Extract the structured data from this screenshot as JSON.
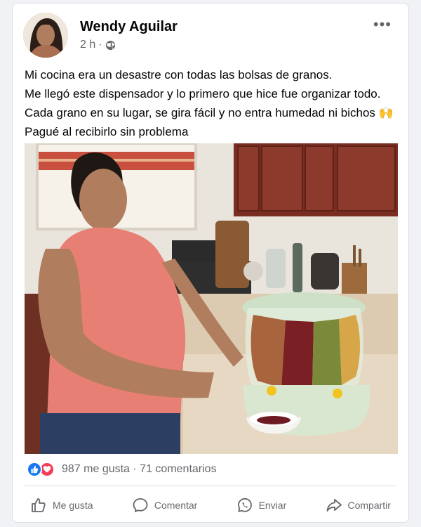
{
  "post": {
    "author_name": "Wendy Aguilar",
    "time": "2 h",
    "separator": "·",
    "privacy_icon": "globe-icon",
    "more_label": "•••",
    "text_lines": [
      "Mi cocina era un desastre con todas las bolsas de granos.",
      "Me llegó este dispensador y lo primero que hice fue organizar todo.",
      "Cada grano en su lugar, se gira fácil y no entra humedad ni bichos 🙌",
      "Pagué al recibirlo sin problema"
    ]
  },
  "reactions": {
    "summary": "987 me gusta · 71 comentarios",
    "icons": [
      "like-reaction-icon",
      "love-reaction-icon"
    ]
  },
  "actions": {
    "like": "Me gusta",
    "comment": "Comentar",
    "send": "Enviar",
    "share": "Compartir"
  },
  "colors": {
    "brand_blue": "#1877f2",
    "love_red": "#f33e58",
    "secondary_text": "#65676b"
  }
}
